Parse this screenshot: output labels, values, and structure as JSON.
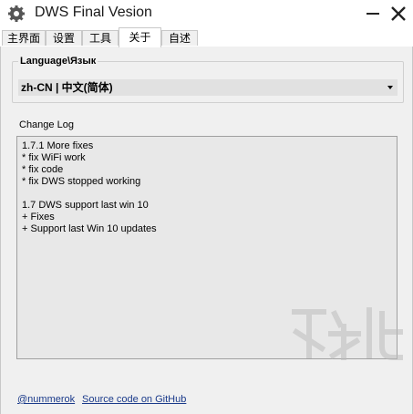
{
  "window": {
    "title": "DWS Final Vesion",
    "icon": "gear-app-icon",
    "controls": [
      "minimize-icon",
      "close-icon"
    ]
  },
  "tabs": [
    {
      "label": "主界面",
      "active": false
    },
    {
      "label": "设置",
      "active": false
    },
    {
      "label": "工具",
      "active": false
    },
    {
      "label": "关于",
      "active": true
    },
    {
      "label": "自述",
      "active": false
    }
  ],
  "language": {
    "group_label": "Language\\Язык",
    "selected": "zh-CN | 中文(简体)"
  },
  "changelog": {
    "label": "Change Log",
    "lines": [
      "1.7.1 More fixes",
      "* fix WiFi work",
      "* fix code",
      "* fix DWS stopped working",
      "",
      "1.7 DWS support last win 10",
      "+ Fixes",
      "+ Support last Win 10 updates"
    ]
  },
  "footer": {
    "author_link": "@nummerok",
    "source_link": "Source code on GitHub"
  },
  "colors": {
    "panel_bg": "#f0f0f0",
    "combo_bg": "#e1e1e1",
    "log_bg": "#e8e8e8",
    "link": "#1a3a8a"
  }
}
